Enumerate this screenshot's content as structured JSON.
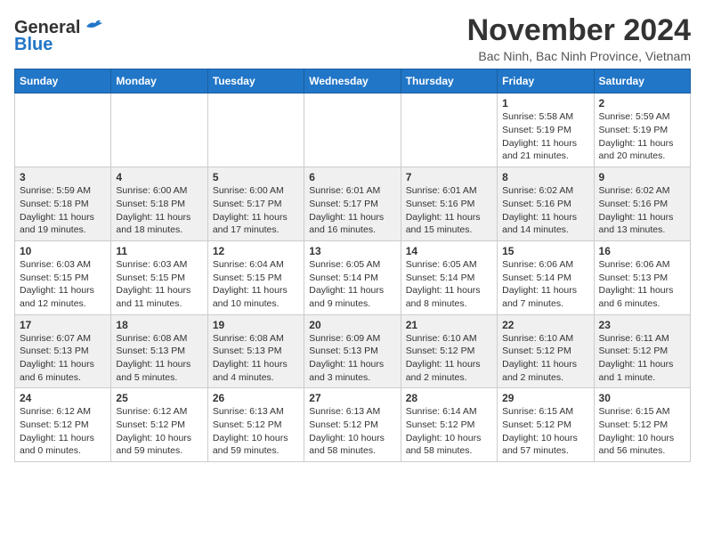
{
  "header": {
    "logo_general": "General",
    "logo_blue": "Blue",
    "title": "November 2024",
    "subtitle": "Bac Ninh, Bac Ninh Province, Vietnam"
  },
  "calendar": {
    "headers": [
      "Sunday",
      "Monday",
      "Tuesday",
      "Wednesday",
      "Thursday",
      "Friday",
      "Saturday"
    ],
    "weeks": [
      [
        {
          "day": "",
          "info": ""
        },
        {
          "day": "",
          "info": ""
        },
        {
          "day": "",
          "info": ""
        },
        {
          "day": "",
          "info": ""
        },
        {
          "day": "",
          "info": ""
        },
        {
          "day": "1",
          "info": "Sunrise: 5:58 AM\nSunset: 5:19 PM\nDaylight: 11 hours and 21 minutes."
        },
        {
          "day": "2",
          "info": "Sunrise: 5:59 AM\nSunset: 5:19 PM\nDaylight: 11 hours and 20 minutes."
        }
      ],
      [
        {
          "day": "3",
          "info": "Sunrise: 5:59 AM\nSunset: 5:18 PM\nDaylight: 11 hours and 19 minutes."
        },
        {
          "day": "4",
          "info": "Sunrise: 6:00 AM\nSunset: 5:18 PM\nDaylight: 11 hours and 18 minutes."
        },
        {
          "day": "5",
          "info": "Sunrise: 6:00 AM\nSunset: 5:17 PM\nDaylight: 11 hours and 17 minutes."
        },
        {
          "day": "6",
          "info": "Sunrise: 6:01 AM\nSunset: 5:17 PM\nDaylight: 11 hours and 16 minutes."
        },
        {
          "day": "7",
          "info": "Sunrise: 6:01 AM\nSunset: 5:16 PM\nDaylight: 11 hours and 15 minutes."
        },
        {
          "day": "8",
          "info": "Sunrise: 6:02 AM\nSunset: 5:16 PM\nDaylight: 11 hours and 14 minutes."
        },
        {
          "day": "9",
          "info": "Sunrise: 6:02 AM\nSunset: 5:16 PM\nDaylight: 11 hours and 13 minutes."
        }
      ],
      [
        {
          "day": "10",
          "info": "Sunrise: 6:03 AM\nSunset: 5:15 PM\nDaylight: 11 hours and 12 minutes."
        },
        {
          "day": "11",
          "info": "Sunrise: 6:03 AM\nSunset: 5:15 PM\nDaylight: 11 hours and 11 minutes."
        },
        {
          "day": "12",
          "info": "Sunrise: 6:04 AM\nSunset: 5:15 PM\nDaylight: 11 hours and 10 minutes."
        },
        {
          "day": "13",
          "info": "Sunrise: 6:05 AM\nSunset: 5:14 PM\nDaylight: 11 hours and 9 minutes."
        },
        {
          "day": "14",
          "info": "Sunrise: 6:05 AM\nSunset: 5:14 PM\nDaylight: 11 hours and 8 minutes."
        },
        {
          "day": "15",
          "info": "Sunrise: 6:06 AM\nSunset: 5:14 PM\nDaylight: 11 hours and 7 minutes."
        },
        {
          "day": "16",
          "info": "Sunrise: 6:06 AM\nSunset: 5:13 PM\nDaylight: 11 hours and 6 minutes."
        }
      ],
      [
        {
          "day": "17",
          "info": "Sunrise: 6:07 AM\nSunset: 5:13 PM\nDaylight: 11 hours and 6 minutes."
        },
        {
          "day": "18",
          "info": "Sunrise: 6:08 AM\nSunset: 5:13 PM\nDaylight: 11 hours and 5 minutes."
        },
        {
          "day": "19",
          "info": "Sunrise: 6:08 AM\nSunset: 5:13 PM\nDaylight: 11 hours and 4 minutes."
        },
        {
          "day": "20",
          "info": "Sunrise: 6:09 AM\nSunset: 5:13 PM\nDaylight: 11 hours and 3 minutes."
        },
        {
          "day": "21",
          "info": "Sunrise: 6:10 AM\nSunset: 5:12 PM\nDaylight: 11 hours and 2 minutes."
        },
        {
          "day": "22",
          "info": "Sunrise: 6:10 AM\nSunset: 5:12 PM\nDaylight: 11 hours and 2 minutes."
        },
        {
          "day": "23",
          "info": "Sunrise: 6:11 AM\nSunset: 5:12 PM\nDaylight: 11 hours and 1 minute."
        }
      ],
      [
        {
          "day": "24",
          "info": "Sunrise: 6:12 AM\nSunset: 5:12 PM\nDaylight: 11 hours and 0 minutes."
        },
        {
          "day": "25",
          "info": "Sunrise: 6:12 AM\nSunset: 5:12 PM\nDaylight: 10 hours and 59 minutes."
        },
        {
          "day": "26",
          "info": "Sunrise: 6:13 AM\nSunset: 5:12 PM\nDaylight: 10 hours and 59 minutes."
        },
        {
          "day": "27",
          "info": "Sunrise: 6:13 AM\nSunset: 5:12 PM\nDaylight: 10 hours and 58 minutes."
        },
        {
          "day": "28",
          "info": "Sunrise: 6:14 AM\nSunset: 5:12 PM\nDaylight: 10 hours and 58 minutes."
        },
        {
          "day": "29",
          "info": "Sunrise: 6:15 AM\nSunset: 5:12 PM\nDaylight: 10 hours and 57 minutes."
        },
        {
          "day": "30",
          "info": "Sunrise: 6:15 AM\nSunset: 5:12 PM\nDaylight: 10 hours and 56 minutes."
        }
      ]
    ]
  }
}
